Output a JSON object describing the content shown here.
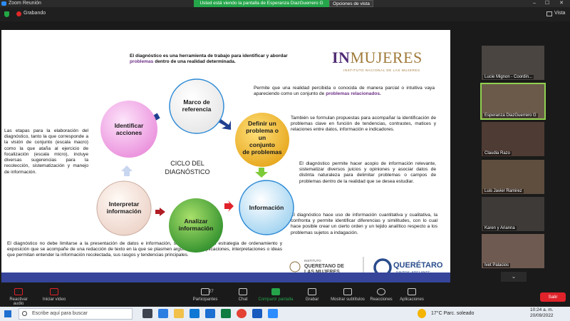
{
  "window": {
    "title": "Zoom Reunión",
    "share_banner": "Usted está viendo la pantalla de Esperanza DiazGuerrero G",
    "view_options": "Opciones de vista",
    "recording_label": "Grabando",
    "view_label": "Vista"
  },
  "slide": {
    "intro_prefix": "El diagnóstico es una herramienta de trabajo para identificar y abordar ",
    "intro_highlight": "problemas",
    "intro_suffix": " dentro de una realidad determinada.",
    "logo_main_a": "IN",
    "logo_main_b": "MUJERES",
    "logo_sub": "INSTITUTO NACIONAL DE LAS MUJERES",
    "right_p1_prefix": "Permite que una realidad percibida o conocida de manera parcial o intuitiva vaya apareciendo como un conjunto de ",
    "right_p1_highlight": "problemas relacionados.",
    "right_p2": "También se formulan propuestas para acompañar la identificación de problemas clave en función de tendencias, contrastes, matices y relaciones entre datos, información e indicadores.",
    "right_p3": "El diagnóstico permite hacer acopio de información relevante, sistematizar diversos juicios y opiniones y asociar datos de distinta naturaleza para delimitar problemas o campos de problemas dentro de la realidad que se desea estudiar.",
    "right_p4": "El diagnóstico hace uso de información cuantitativa y cualitativa, la confronta y permite identificar diferencias y similitudes, con lo cual hace posible crear un cierto orden y un tejido analítico respecto a los problemas sujetos a indagación.",
    "left_text": "Las etapas para la elaboración del diagnóstico, tanto la que corresponde a la visión de conjunto (escala macro) como la que ataña al ejercicio de focalización (escala micro), incluye diversas sugerencias para la recolección, sistematización y manejo de información.",
    "bottom_text": "El diagnóstico no debe limitarse a la presentación de datos e información, sino que exige una estrategia de ordenamiento y exposición que se acompañe de una redacción de texto en la que se plasmen argumentos, explicaciones, interpretaciones o ideas que permitan entender la información recolectada, sus rasgos y tendencias principales.",
    "cycle_title_1": "CICLO DEL",
    "cycle_title_2": "DIAGNÓSTICO",
    "cycle_steps": [
      {
        "label_1": "Marco de",
        "label_2": "referencia",
        "label_3": "",
        "label_4": "",
        "label_5": ""
      },
      {
        "label_1": "Definir un",
        "label_2": "problema o",
        "label_3": "un",
        "label_4": "conjunto",
        "label_5": "de problemas"
      },
      {
        "label_1": "Información",
        "label_2": "",
        "label_3": "",
        "label_4": "",
        "label_5": ""
      },
      {
        "label_1": "Analizar",
        "label_2": "información",
        "label_3": "",
        "label_4": "",
        "label_5": ""
      },
      {
        "label_1": "Interpretar",
        "label_2": "información",
        "label_3": "",
        "label_4": "",
        "label_5": ""
      },
      {
        "label_1": "Identificar",
        "label_2": "acciones",
        "label_3": "",
        "label_4": "",
        "label_5": ""
      }
    ],
    "colors": {
      "step_white": "#ffffff",
      "step_yellow": "#f6c945",
      "step_blue": "#cfe8f7",
      "step_green": "#5cae3c",
      "step_beige": "#f6e7e0",
      "step_pink": "#f7b9ee",
      "highlight": "#6c2f86"
    },
    "queretaro_inst_1": "INSTITUTO",
    "queretaro_inst_2": "QUERETANO DE",
    "queretaro_inst_3": "LAS MUJERES",
    "queretaro_name": "QUERÉTARO",
    "queretaro_tagline": "JUNTOS, ADELANTE."
  },
  "participants": [
    {
      "name": "Lucie Mignon - Coordin..."
    },
    {
      "name": "Esperanza DiazGuerrero G"
    },
    {
      "name": "Claudia Razo"
    },
    {
      "name": "Luis Javier Ramirez"
    },
    {
      "name": "Karen y Arianna"
    },
    {
      "name": "Ivet Palacios"
    }
  ],
  "toolbar": {
    "audio": "Reactivar audio",
    "video": "Iniciar vídeo",
    "participants": "Participantes",
    "participants_count": "27",
    "chat": "Chat",
    "share": "Compartir pantalla",
    "record": "Grabar",
    "subtitles": "Mostrar subtítulos",
    "reactions": "Reacciones",
    "apps": "Aplicaciones",
    "leave": "Salir"
  },
  "taskbar": {
    "search_placeholder": "Escribe aquí para buscar",
    "weather": "17°C  Parc. soleado",
    "time": "10:24 a. m.",
    "date": "20/09/2022"
  }
}
